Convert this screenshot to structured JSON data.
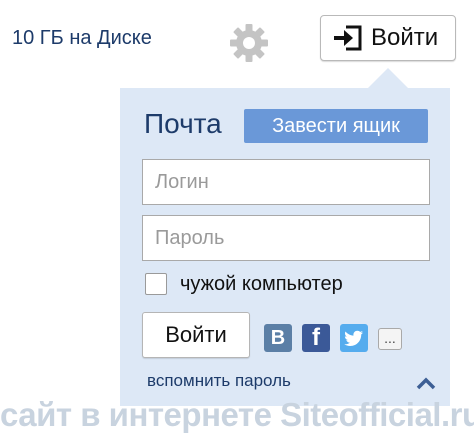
{
  "header": {
    "disk_text": "10 ГБ на Диске",
    "login_button_label": "Войти",
    "settings_icon": "gear-icon",
    "login_icon": "enter-icon"
  },
  "mail_panel": {
    "title": "Почта",
    "create_button_label": "Завести ящик",
    "login_placeholder": "Логин",
    "login_value": "",
    "password_placeholder": "Пароль",
    "password_value": "",
    "foreign_computer_label": "чужой компьютер",
    "foreign_computer_checked": false,
    "submit_label": "Войти",
    "social": [
      {
        "name": "vk",
        "glyph": "В",
        "color": "#5b7fa6"
      },
      {
        "name": "facebook",
        "glyph": "f",
        "color": "#3b5998"
      },
      {
        "name": "twitter",
        "glyph": "bird",
        "color": "#55acee"
      },
      {
        "name": "more",
        "glyph": "..."
      }
    ],
    "forgot_password_label": "вспомнить пароль",
    "collapse_icon": "chevron-up-icon",
    "background_color": "#dde8f6",
    "accent_color": "#6a98d8"
  },
  "watermark": {
    "text": "сайт в интернете Siteofficial.ru"
  }
}
